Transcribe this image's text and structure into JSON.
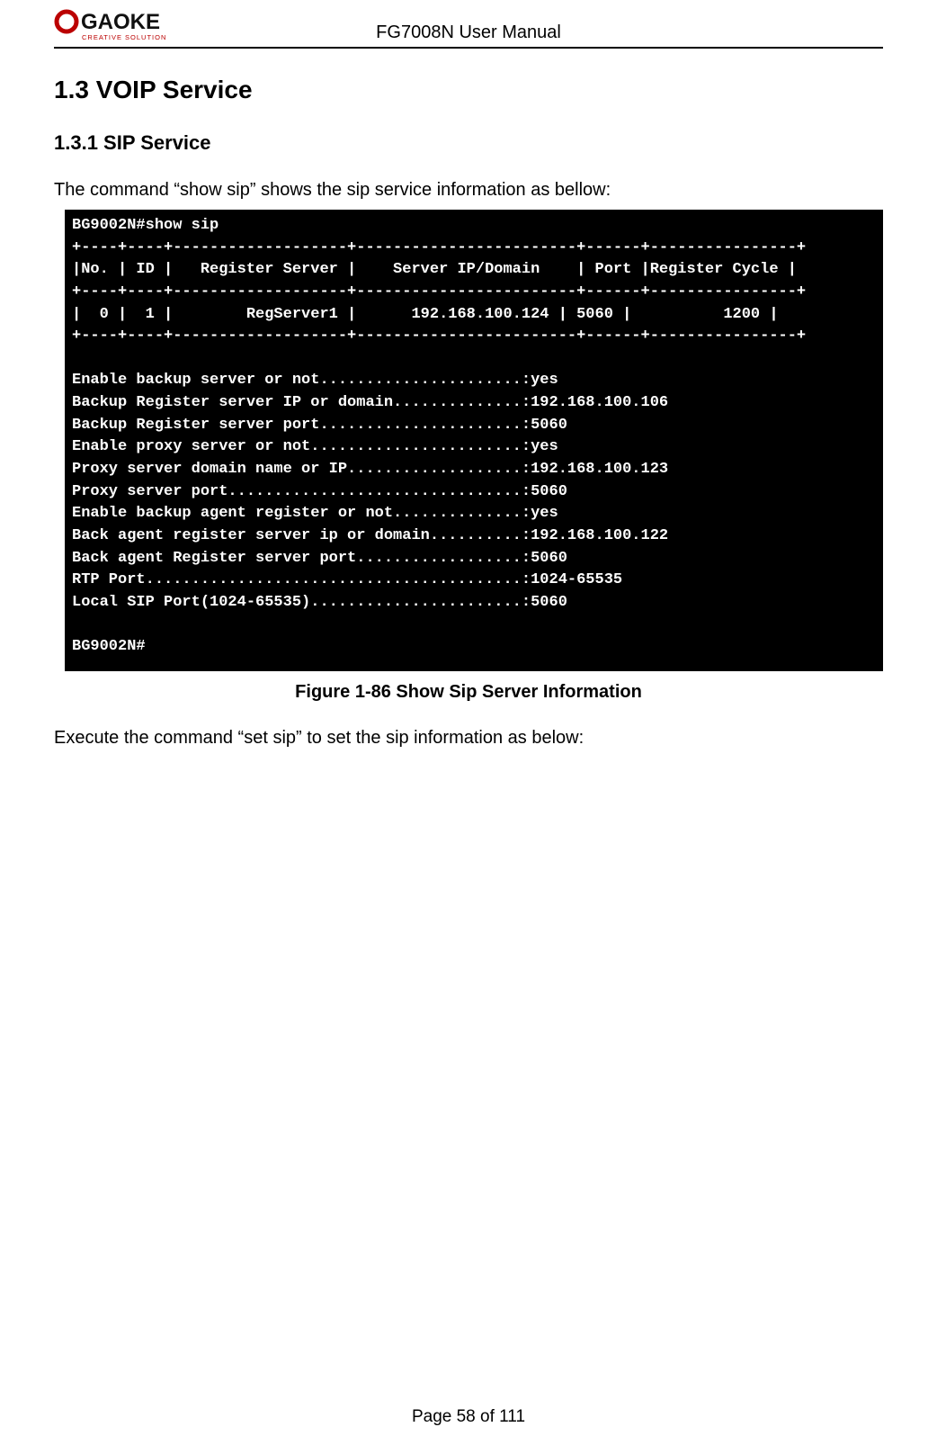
{
  "header": {
    "brand": "GAOKE",
    "tagline": "CREATIVE SOLUTION",
    "title": "FG7008N User Manual"
  },
  "section": {
    "num_title": "1.3  VOIP Service",
    "sub_num_title": "1.3.1    SIP Service",
    "intro": "The command “show sip” shows the sip service information as bellow:"
  },
  "terminal": {
    "prompt1": "BG9002N#show sip",
    "sep1": "+----+----+-------------------+------------------------+------+----------------+",
    "header_row": "|No. | ID |   Register Server |    Server IP/Domain    | Port |Register Cycle |",
    "sep2": "+----+----+-------------------+------------------------+------+----------------+",
    "data_row": "|  0 |  1 |        RegServer1 |      192.168.100.124 | 5060 |          1200 |",
    "sep3": "+----+----+-------------------+------------------------+------+----------------+",
    "lines": [
      "Enable backup server or not......................:yes",
      "Backup Register server IP or domain..............:192.168.100.106",
      "Backup Register server port......................:5060",
      "Enable proxy server or not.......................:yes",
      "Proxy server domain name or IP...................:192.168.100.123",
      "Proxy server port................................:5060",
      "Enable backup agent register or not..............:yes",
      "Back agent register server ip or domain..........:192.168.100.122",
      "Back agent Register server port..................:5060",
      "RTP Port.........................................:1024-65535",
      "Local SIP Port(1024-65535).......................:5060"
    ],
    "prompt2": "BG9002N#"
  },
  "figure_caption": "Figure 1-86   Show Sip Server Information",
  "after_fig": "Execute the command “set sip” to set the sip information as below:",
  "footer": "Page 58 of 111"
}
